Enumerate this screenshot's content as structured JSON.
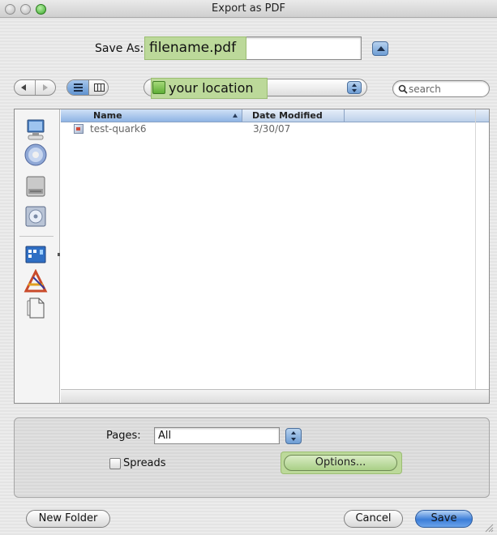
{
  "window": {
    "title": "Export as PDF"
  },
  "save_as": {
    "label": "Save As:",
    "filename": "filename.pdf"
  },
  "toolbar": {
    "location": "your location",
    "search_placeholder": "search"
  },
  "file_list": {
    "columns": {
      "name": "Name",
      "date_modified": "Date Modified"
    },
    "rows": [
      {
        "name": "test-quark6",
        "date_modified": "3/30/07"
      }
    ]
  },
  "options": {
    "pages_label": "Pages:",
    "pages_value": "All",
    "spreads_label": "Spreads",
    "spreads_checked": false,
    "options_button": "Options..."
  },
  "buttons": {
    "new_folder": "New Folder",
    "cancel": "Cancel",
    "save": "Save"
  },
  "colors": {
    "highlight_green": "#bcd99a",
    "default_button_blue": "#3b7dd8",
    "selected_header_blue": "#8fb4e4"
  }
}
